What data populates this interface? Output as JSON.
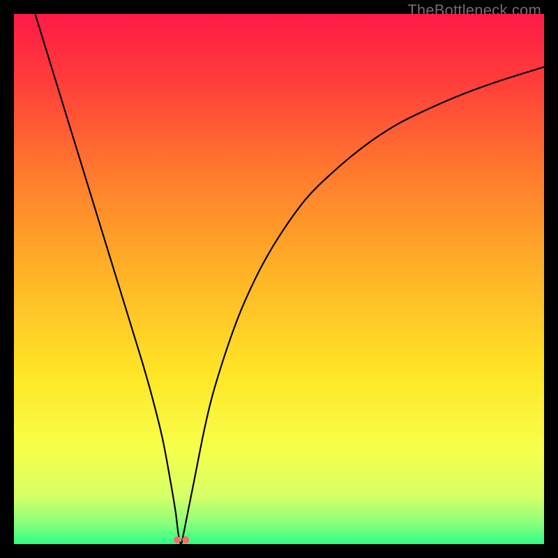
{
  "watermark": "TheBottleneck.com",
  "chart_data": {
    "type": "line",
    "title": "",
    "xlabel": "",
    "ylabel": "",
    "xlim": [
      0,
      100
    ],
    "ylim": [
      0,
      100
    ],
    "grid": false,
    "background_gradient": {
      "stops": [
        {
          "offset": 0.0,
          "color": "#ff1a47"
        },
        {
          "offset": 0.12,
          "color": "#ff3b3b"
        },
        {
          "offset": 0.3,
          "color": "#ff7a2d"
        },
        {
          "offset": 0.5,
          "color": "#ffb626"
        },
        {
          "offset": 0.68,
          "color": "#ffe626"
        },
        {
          "offset": 0.82,
          "color": "#f7ff4a"
        },
        {
          "offset": 0.91,
          "color": "#d6ff66"
        },
        {
          "offset": 0.96,
          "color": "#8cff7a"
        },
        {
          "offset": 1.0,
          "color": "#2bff86"
        }
      ]
    },
    "series": [
      {
        "name": "bottleneck-curve",
        "color": "#000000",
        "width": 2.2,
        "x": [
          4,
          8,
          12,
          16,
          20,
          24,
          26,
          28,
          29.5,
          30.5,
          31,
          31.5,
          32,
          33,
          34,
          36,
          38,
          42,
          46,
          50,
          55,
          60,
          66,
          72,
          78,
          85,
          92,
          100
        ],
        "y": [
          100,
          87,
          74,
          61,
          48,
          35,
          28,
          20,
          12,
          6,
          2,
          0,
          2,
          7,
          12,
          22,
          30,
          42,
          51,
          58,
          65,
          70,
          75,
          79,
          82,
          85,
          87.5,
          90
        ]
      }
    ],
    "markers": [
      {
        "name": "minimum-marker-left",
        "x": 30.8,
        "y": 0.8,
        "color": "#ff6a6a",
        "r": 5
      },
      {
        "name": "minimum-marker-right",
        "x": 32.4,
        "y": 0.8,
        "color": "#ff6a6a",
        "r": 5
      }
    ]
  }
}
